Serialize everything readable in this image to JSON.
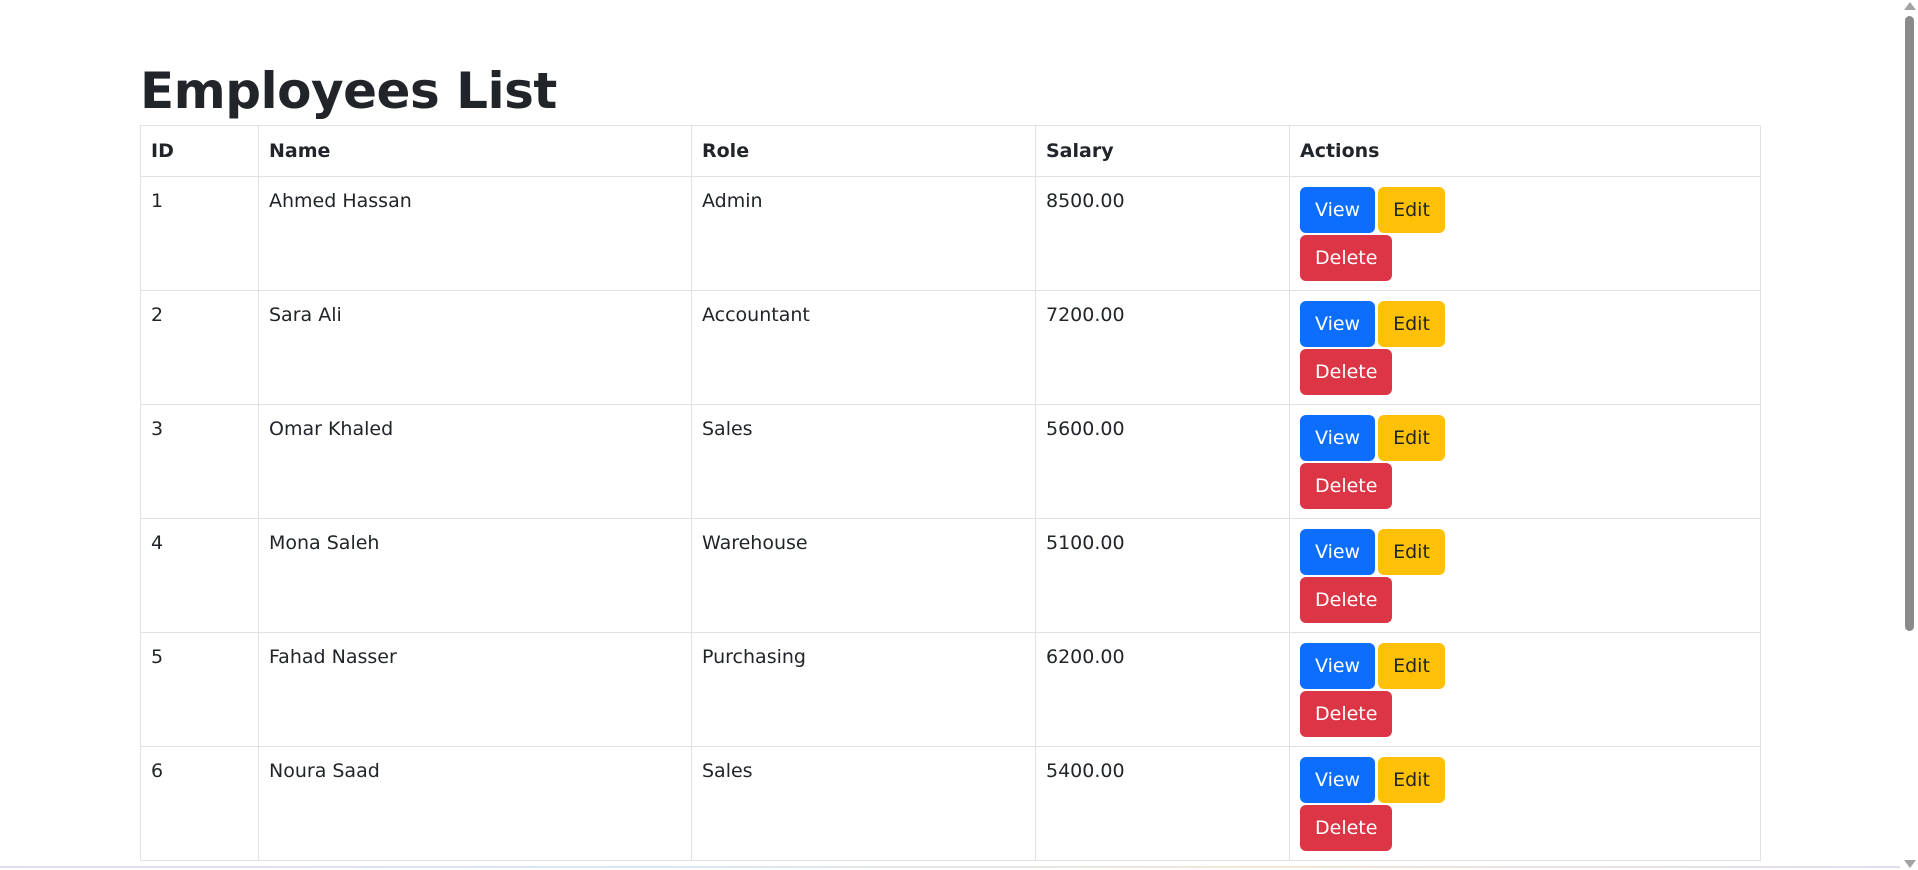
{
  "page": {
    "title": "Employees List"
  },
  "table": {
    "columns": [
      "ID",
      "Name",
      "Role",
      "Salary",
      "Actions"
    ],
    "rows": [
      {
        "id": "1",
        "name": "Ahmed Hassan",
        "role": "Admin",
        "salary": "8500.00"
      },
      {
        "id": "2",
        "name": "Sara Ali",
        "role": "Accountant",
        "salary": "7200.00"
      },
      {
        "id": "3",
        "name": "Omar Khaled",
        "role": "Sales",
        "salary": "5600.00"
      },
      {
        "id": "4",
        "name": "Mona Saleh",
        "role": "Warehouse",
        "salary": "5100.00"
      },
      {
        "id": "5",
        "name": "Fahad Nasser",
        "role": "Purchasing",
        "salary": "6200.00"
      },
      {
        "id": "6",
        "name": "Noura Saad",
        "role": "Sales",
        "salary": "5400.00"
      }
    ]
  },
  "actions": {
    "view_label": "View",
    "edit_label": "Edit",
    "delete_label": "Delete"
  },
  "colors": {
    "view": "#0d6efd",
    "edit": "#ffc107",
    "delete": "#dc3545"
  }
}
